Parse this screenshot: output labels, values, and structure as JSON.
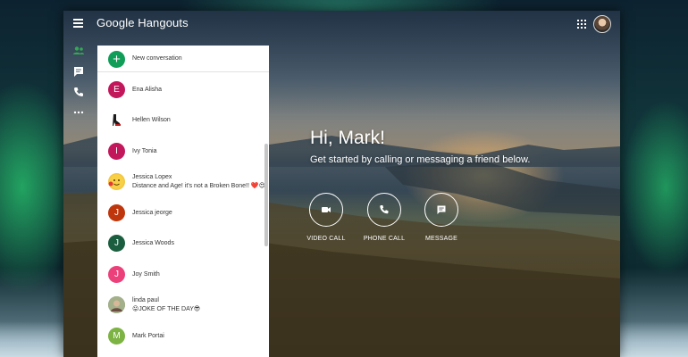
{
  "app": {
    "brand": "Google Hangouts"
  },
  "rail": {
    "items": [
      {
        "icon": "people-icon"
      },
      {
        "icon": "chat-icon"
      },
      {
        "icon": "phone-icon"
      },
      {
        "icon": "more-icon"
      }
    ]
  },
  "panel": {
    "new_conversation": "New conversation",
    "contacts": [
      {
        "name": "Ena Alisha",
        "initial": "E",
        "color": "#c2185b",
        "message": ""
      },
      {
        "name": "Hellen Wilson",
        "initial": "",
        "color": "#ffffff",
        "message": ""
      },
      {
        "name": "Ivy Tonia",
        "initial": "I",
        "color": "#c2185b",
        "message": ""
      },
      {
        "name": "Jessica Lopex",
        "initial": "",
        "color": "#f4c542",
        "message": "Distance and Age! it's not a Broken Bone!! ❤️😍"
      },
      {
        "name": "Jessica jeorge",
        "initial": "J",
        "color": "#bf360c",
        "message": ""
      },
      {
        "name": "Jessica Woods",
        "initial": "J",
        "color": "#1b5e3f",
        "message": ""
      },
      {
        "name": "Joy Smith",
        "initial": "J",
        "color": "#ec407a",
        "message": ""
      },
      {
        "name": "linda paul",
        "initial": "",
        "color": "#8a9a7a",
        "message": "😛JOKE OF THE DAY😎"
      },
      {
        "name": "Mark Portai",
        "initial": "M",
        "color": "#7cb342",
        "message": ""
      }
    ]
  },
  "main": {
    "greeting": "Hi, Mark!",
    "subtitle": "Get started by calling or messaging a friend below.",
    "actions": [
      {
        "label": "VIDEO CALL",
        "icon": "video-camera-icon"
      },
      {
        "label": "PHONE CALL",
        "icon": "phone-icon"
      },
      {
        "label": "MESSAGE",
        "icon": "message-icon"
      }
    ]
  },
  "colors": {
    "accent": "#0f9d58",
    "rail_active": "#34a853"
  }
}
